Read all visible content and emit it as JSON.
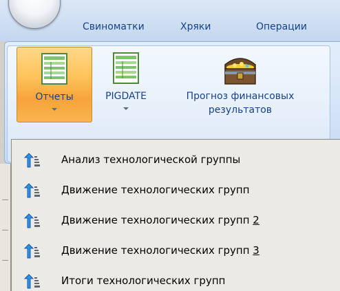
{
  "app_menu": {
    "icon": "app-orb-icon"
  },
  "tabs": [
    {
      "label": "Свиноматки"
    },
    {
      "label": "Хряки"
    },
    {
      "label": "Операции"
    }
  ],
  "ribbon": {
    "buttons": [
      {
        "label": "Отчеты",
        "icon": "report-sheet-icon",
        "has_dropdown": true,
        "state": "pressed"
      },
      {
        "label": "PIGDATE",
        "icon": "report-sheet-icon",
        "has_dropdown": true
      },
      {
        "label_line1": "Прогноз финансовых",
        "label_line2": "результатов",
        "icon": "treasure-chest-icon"
      }
    ]
  },
  "dropdown": {
    "items": [
      {
        "label": "Анализ технологической группы",
        "icon": "sort-ascending-icon"
      },
      {
        "label": "Движение технологических групп",
        "icon": "sort-ascending-icon"
      },
      {
        "label": "Движение технологических групп ",
        "accel": "2",
        "icon": "sort-ascending-icon"
      },
      {
        "label": "Движение технологических групп ",
        "accel": "3",
        "icon": "sort-ascending-icon"
      },
      {
        "label": "Итоги технологических групп",
        "icon": "sort-ascending-icon"
      }
    ]
  },
  "colors": {
    "ribbon_text": "#15428b",
    "pressed_button": "#f7a33a",
    "menu_background": "#eceae4"
  }
}
